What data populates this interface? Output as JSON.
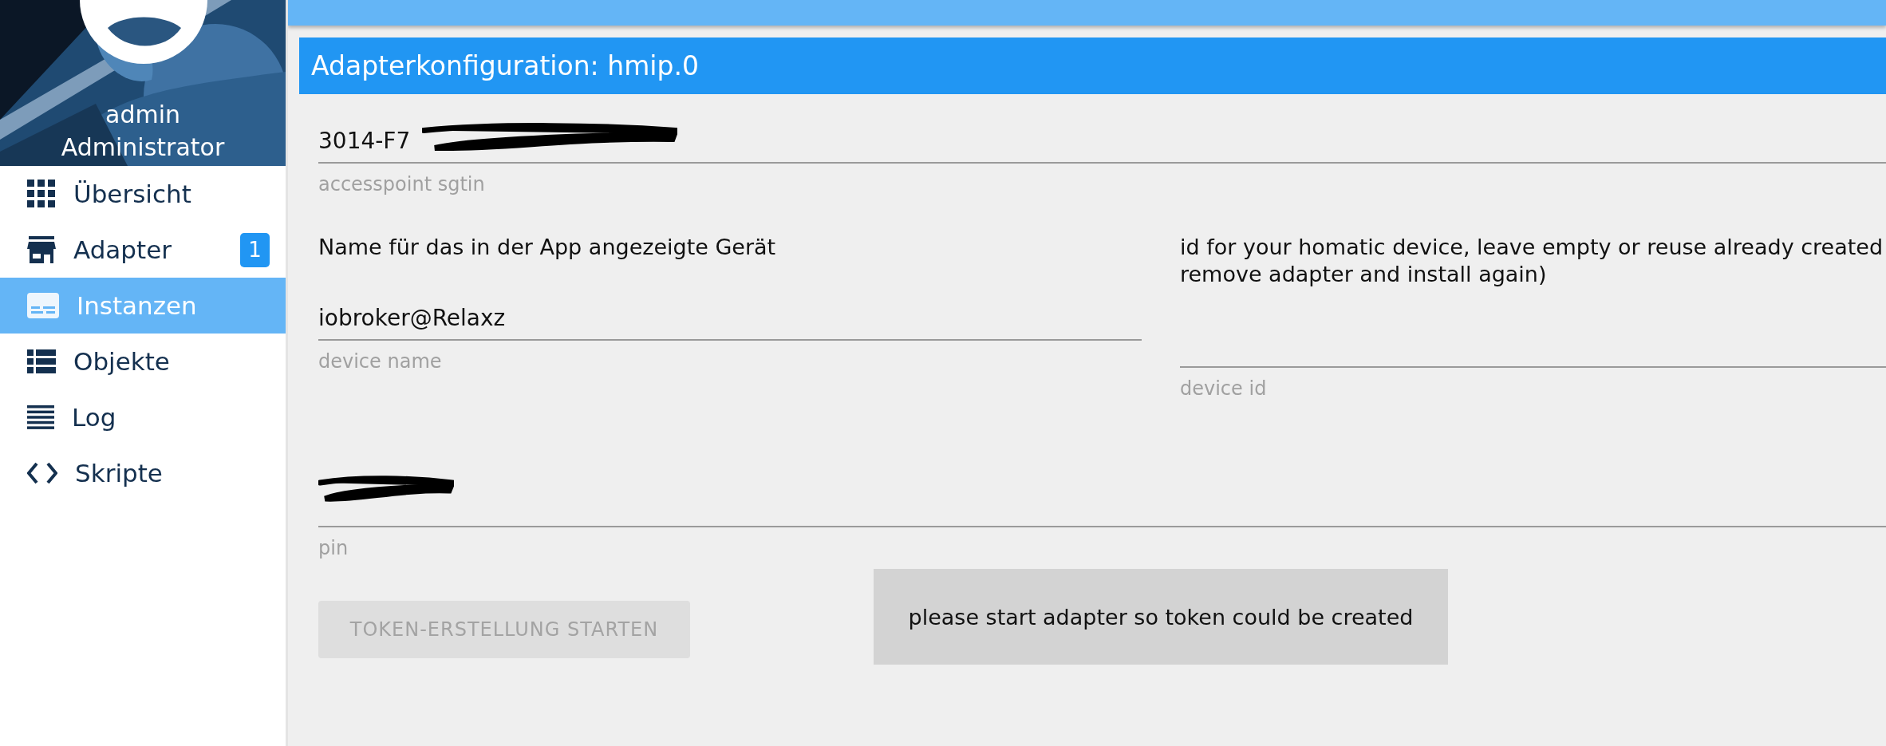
{
  "sidebar": {
    "user": {
      "name": "admin",
      "role": "Administrator"
    },
    "items": [
      {
        "label": "Übersicht",
        "kind": "grid",
        "selected": false
      },
      {
        "label": "Adapter",
        "kind": "store",
        "badge": "1",
        "selected": false
      },
      {
        "label": "Instanzen",
        "kind": "instances",
        "selected": true
      },
      {
        "label": "Objekte",
        "kind": "list",
        "selected": false
      },
      {
        "label": "Log",
        "kind": "lines",
        "selected": false
      },
      {
        "label": "Skripte",
        "kind": "code",
        "selected": false
      }
    ]
  },
  "config": {
    "title": "Adapterkonfiguration: hmip.0",
    "sgtin": {
      "value": "3014-F7",
      "helper": "accesspoint sgtin",
      "redacted": true
    },
    "device_name": {
      "description": "Name für das in der App angezeigte Gerät",
      "value": "iobroker@Relaxz",
      "helper": "device name"
    },
    "device_id": {
      "description_lines": [
        "id for your homatic device, leave empty or reuse already created",
        "remove adapter and install again)"
      ],
      "helper": "device id"
    },
    "pin": {
      "helper": "pin",
      "redacted": true
    },
    "token_button": {
      "label": "TOKEN-ERSTELLUNG STARTEN",
      "disabled": true
    },
    "message": "please start adapter so token could be created"
  }
}
